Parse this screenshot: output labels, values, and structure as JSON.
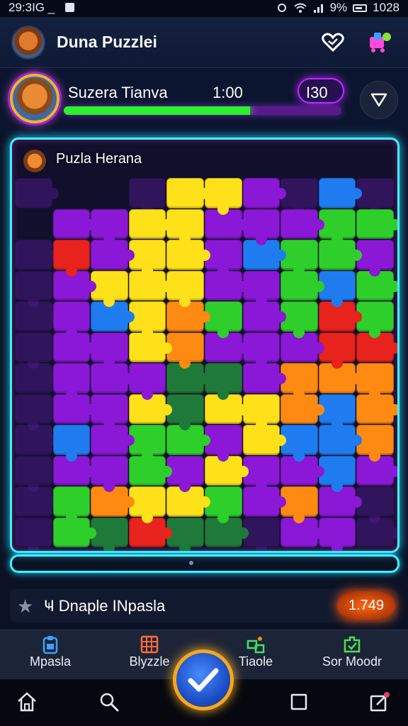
{
  "status_bar": {
    "time": "29:3IG",
    "dash": "_",
    "battery_text": "9%",
    "right_time": "1028"
  },
  "header": {
    "title": "Duna Puzzlei"
  },
  "player": {
    "name": "Suzera Tianva",
    "time": "1:00",
    "score": "I30",
    "progress_pct": 67
  },
  "board": {
    "title": "Puzla Herana"
  },
  "info": {
    "text": "Ҹ Dnaple INpasla",
    "value": "1.749"
  },
  "tabs": [
    {
      "label": "Mpasla",
      "icon": "clipboard-icon",
      "color": "#3fa0ff"
    },
    {
      "label": "Blyzzle",
      "icon": "grid-icon",
      "color": "#ff6a3a"
    },
    {
      "label": "Tiaole",
      "icon": "puzzle-icon",
      "color": "#3ee06a"
    },
    {
      "label": "Sor Moodr",
      "icon": "shield-icon",
      "color": "#4ee04e"
    }
  ],
  "palette": {
    "red": "#e8221c",
    "yellow": "#ffe11a",
    "purple": "#8a18d6",
    "green": "#2ecf2a",
    "blue": "#1e7cf0",
    "orange": "#ff8a12",
    "dark_green": "#1f7a3a",
    "dark_purple": "#4a1a86"
  }
}
